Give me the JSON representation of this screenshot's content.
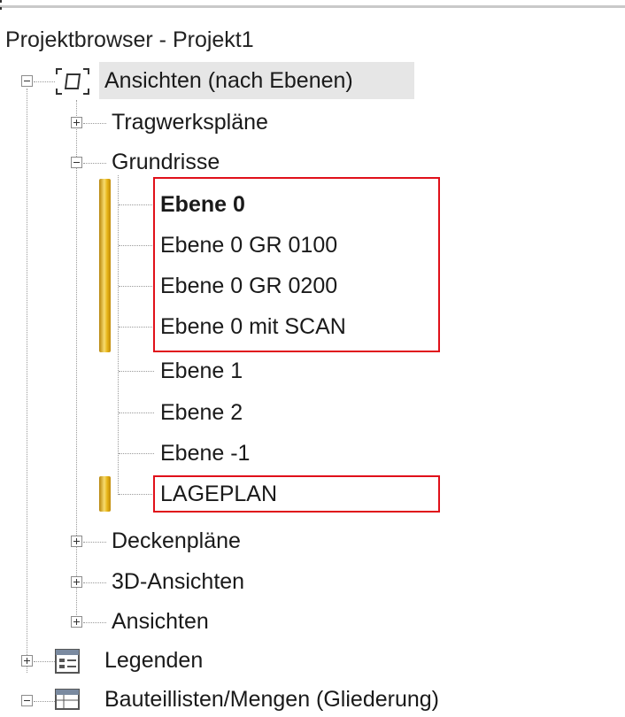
{
  "header": {
    "title": "Projektbrowser - Projekt1"
  },
  "colors": {
    "highlight_box": "#e0101a",
    "selection_bg": "#e6e6e6",
    "marker_gold": "#f7dc6f"
  },
  "tree": {
    "root": {
      "label": "Ansichten (nach Ebenen)",
      "icon": "view-frame-icon",
      "expanded": true
    },
    "tragwerksplaene": {
      "label": "Tragwerkspläne",
      "expanded": false
    },
    "grundrisse": {
      "label": "Grundrisse",
      "expanded": true,
      "items": [
        {
          "label": "Ebene 0"
        },
        {
          "label": "Ebene 0 GR 0100"
        },
        {
          "label": "Ebene 0 GR 0200"
        },
        {
          "label": "Ebene 0 mit SCAN"
        },
        {
          "label": "Ebene 1"
        },
        {
          "label": "Ebene 2"
        },
        {
          "label": "Ebene -1"
        },
        {
          "label": "LAGEPLAN"
        }
      ]
    },
    "deckenplaene": {
      "label": "Deckenpläne",
      "expanded": false
    },
    "ansichten_3d": {
      "label": "3D-Ansichten",
      "expanded": false
    },
    "ansichten": {
      "label": "Ansichten",
      "expanded": false
    },
    "legenden": {
      "label": "Legenden",
      "icon": "legend-icon",
      "expanded": false
    },
    "bauteillisten": {
      "label": "Bauteillisten/Mengen (Gliederung)",
      "icon": "schedule-icon",
      "expanded": true
    }
  }
}
